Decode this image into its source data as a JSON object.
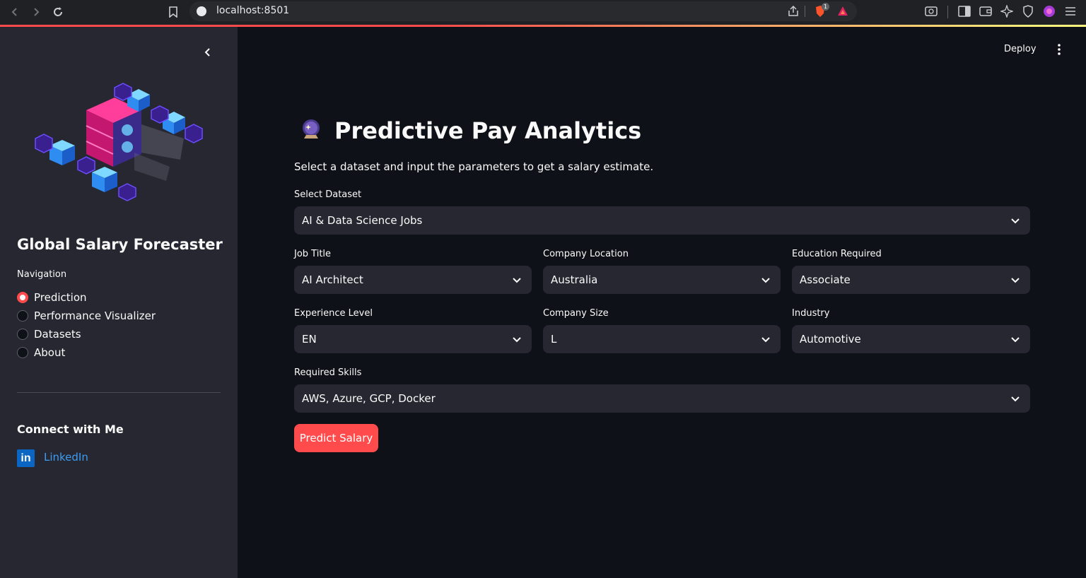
{
  "browser": {
    "url": "localhost:8501",
    "shield_badge": "1"
  },
  "sidebar": {
    "title": "Global Salary Forecaster",
    "nav_label": "Navigation",
    "nav_items": [
      {
        "label": "Prediction",
        "selected": true
      },
      {
        "label": "Performance Visualizer",
        "selected": false
      },
      {
        "label": "Datasets",
        "selected": false
      },
      {
        "label": "About",
        "selected": false
      }
    ],
    "connect_title": "Connect with Me",
    "linkedin_label": "LinkedIn",
    "linkedin_icon_text": "in"
  },
  "header": {
    "deploy_label": "Deploy"
  },
  "main": {
    "title": "Predictive Pay Analytics",
    "subtitle": "Select a dataset and input the parameters to get a salary estimate.",
    "dataset": {
      "label": "Select Dataset",
      "value": "AI & Data Science Jobs"
    },
    "job_title": {
      "label": "Job Title",
      "value": "AI Architect"
    },
    "company_location": {
      "label": "Company Location",
      "value": "Australia"
    },
    "education": {
      "label": "Education Required",
      "value": "Associate"
    },
    "experience": {
      "label": "Experience Level",
      "value": "EN"
    },
    "company_size": {
      "label": "Company Size",
      "value": "L"
    },
    "industry": {
      "label": "Industry",
      "value": "Automotive"
    },
    "skills": {
      "label": "Required Skills",
      "value": "AWS, Azure, GCP, Docker"
    },
    "predict_label": "Predict Salary"
  },
  "colors": {
    "accent": "#ff4b4b",
    "sidebar_bg": "#262730",
    "main_bg": "#0e1117",
    "link": "#3d9df3"
  }
}
